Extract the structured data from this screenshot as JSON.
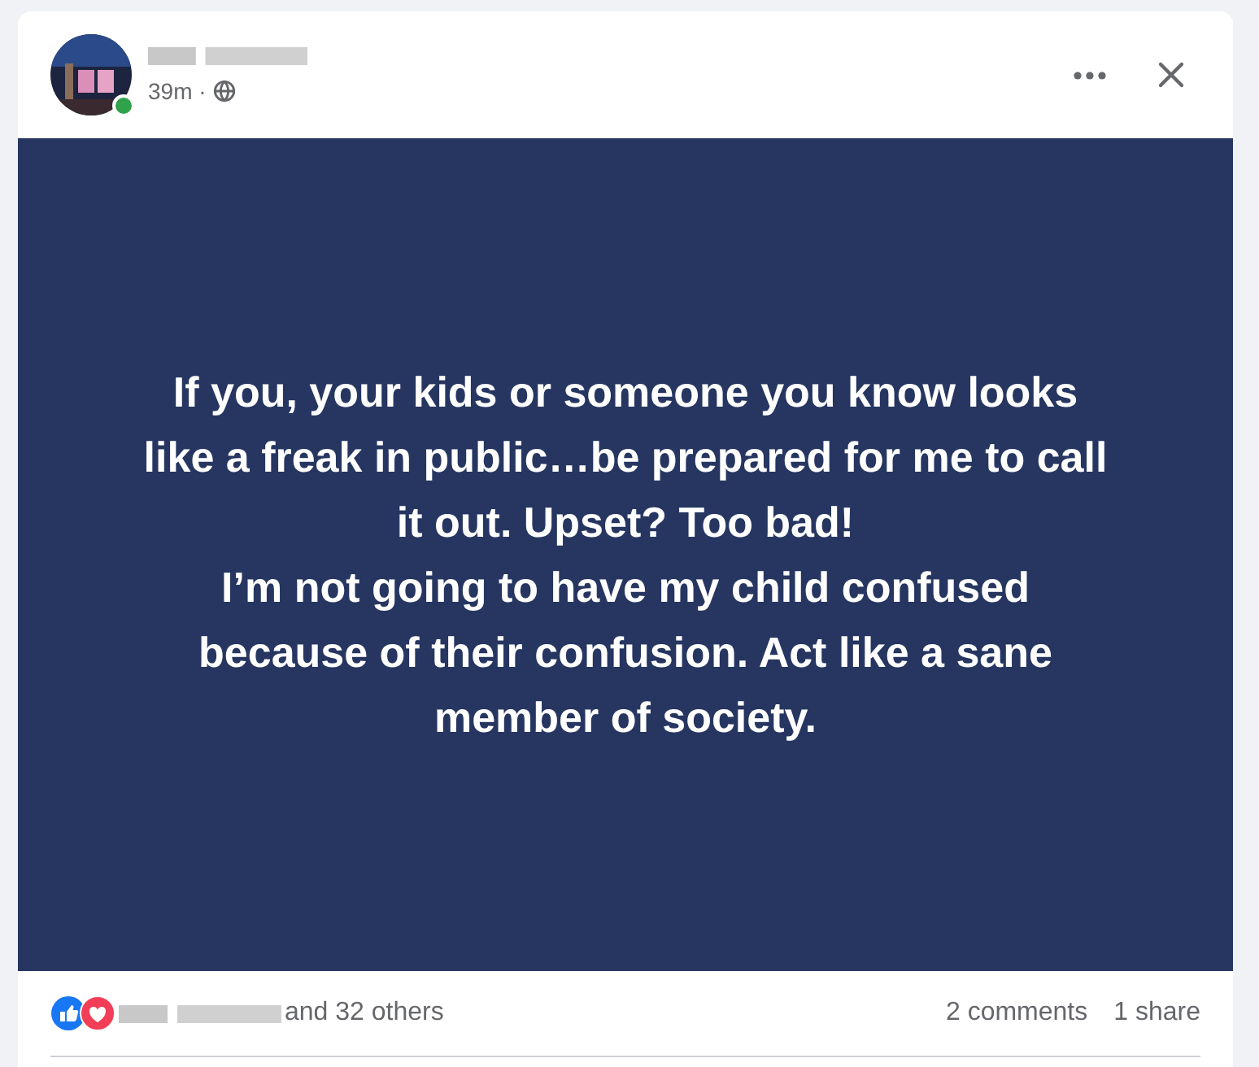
{
  "post": {
    "author": {
      "online": true
    },
    "time": "39m ·",
    "paragraphs": [
      "If you, your kids or someone you know looks like a freak in public…be prepared for me to call it out. Upset? Too bad!",
      "I’m not going to have my child confused because of their confusion. Act like a sane member of society."
    ]
  },
  "footer": {
    "reactions_text": "and 32 others",
    "comments": "2 comments",
    "shares": "1 share"
  }
}
